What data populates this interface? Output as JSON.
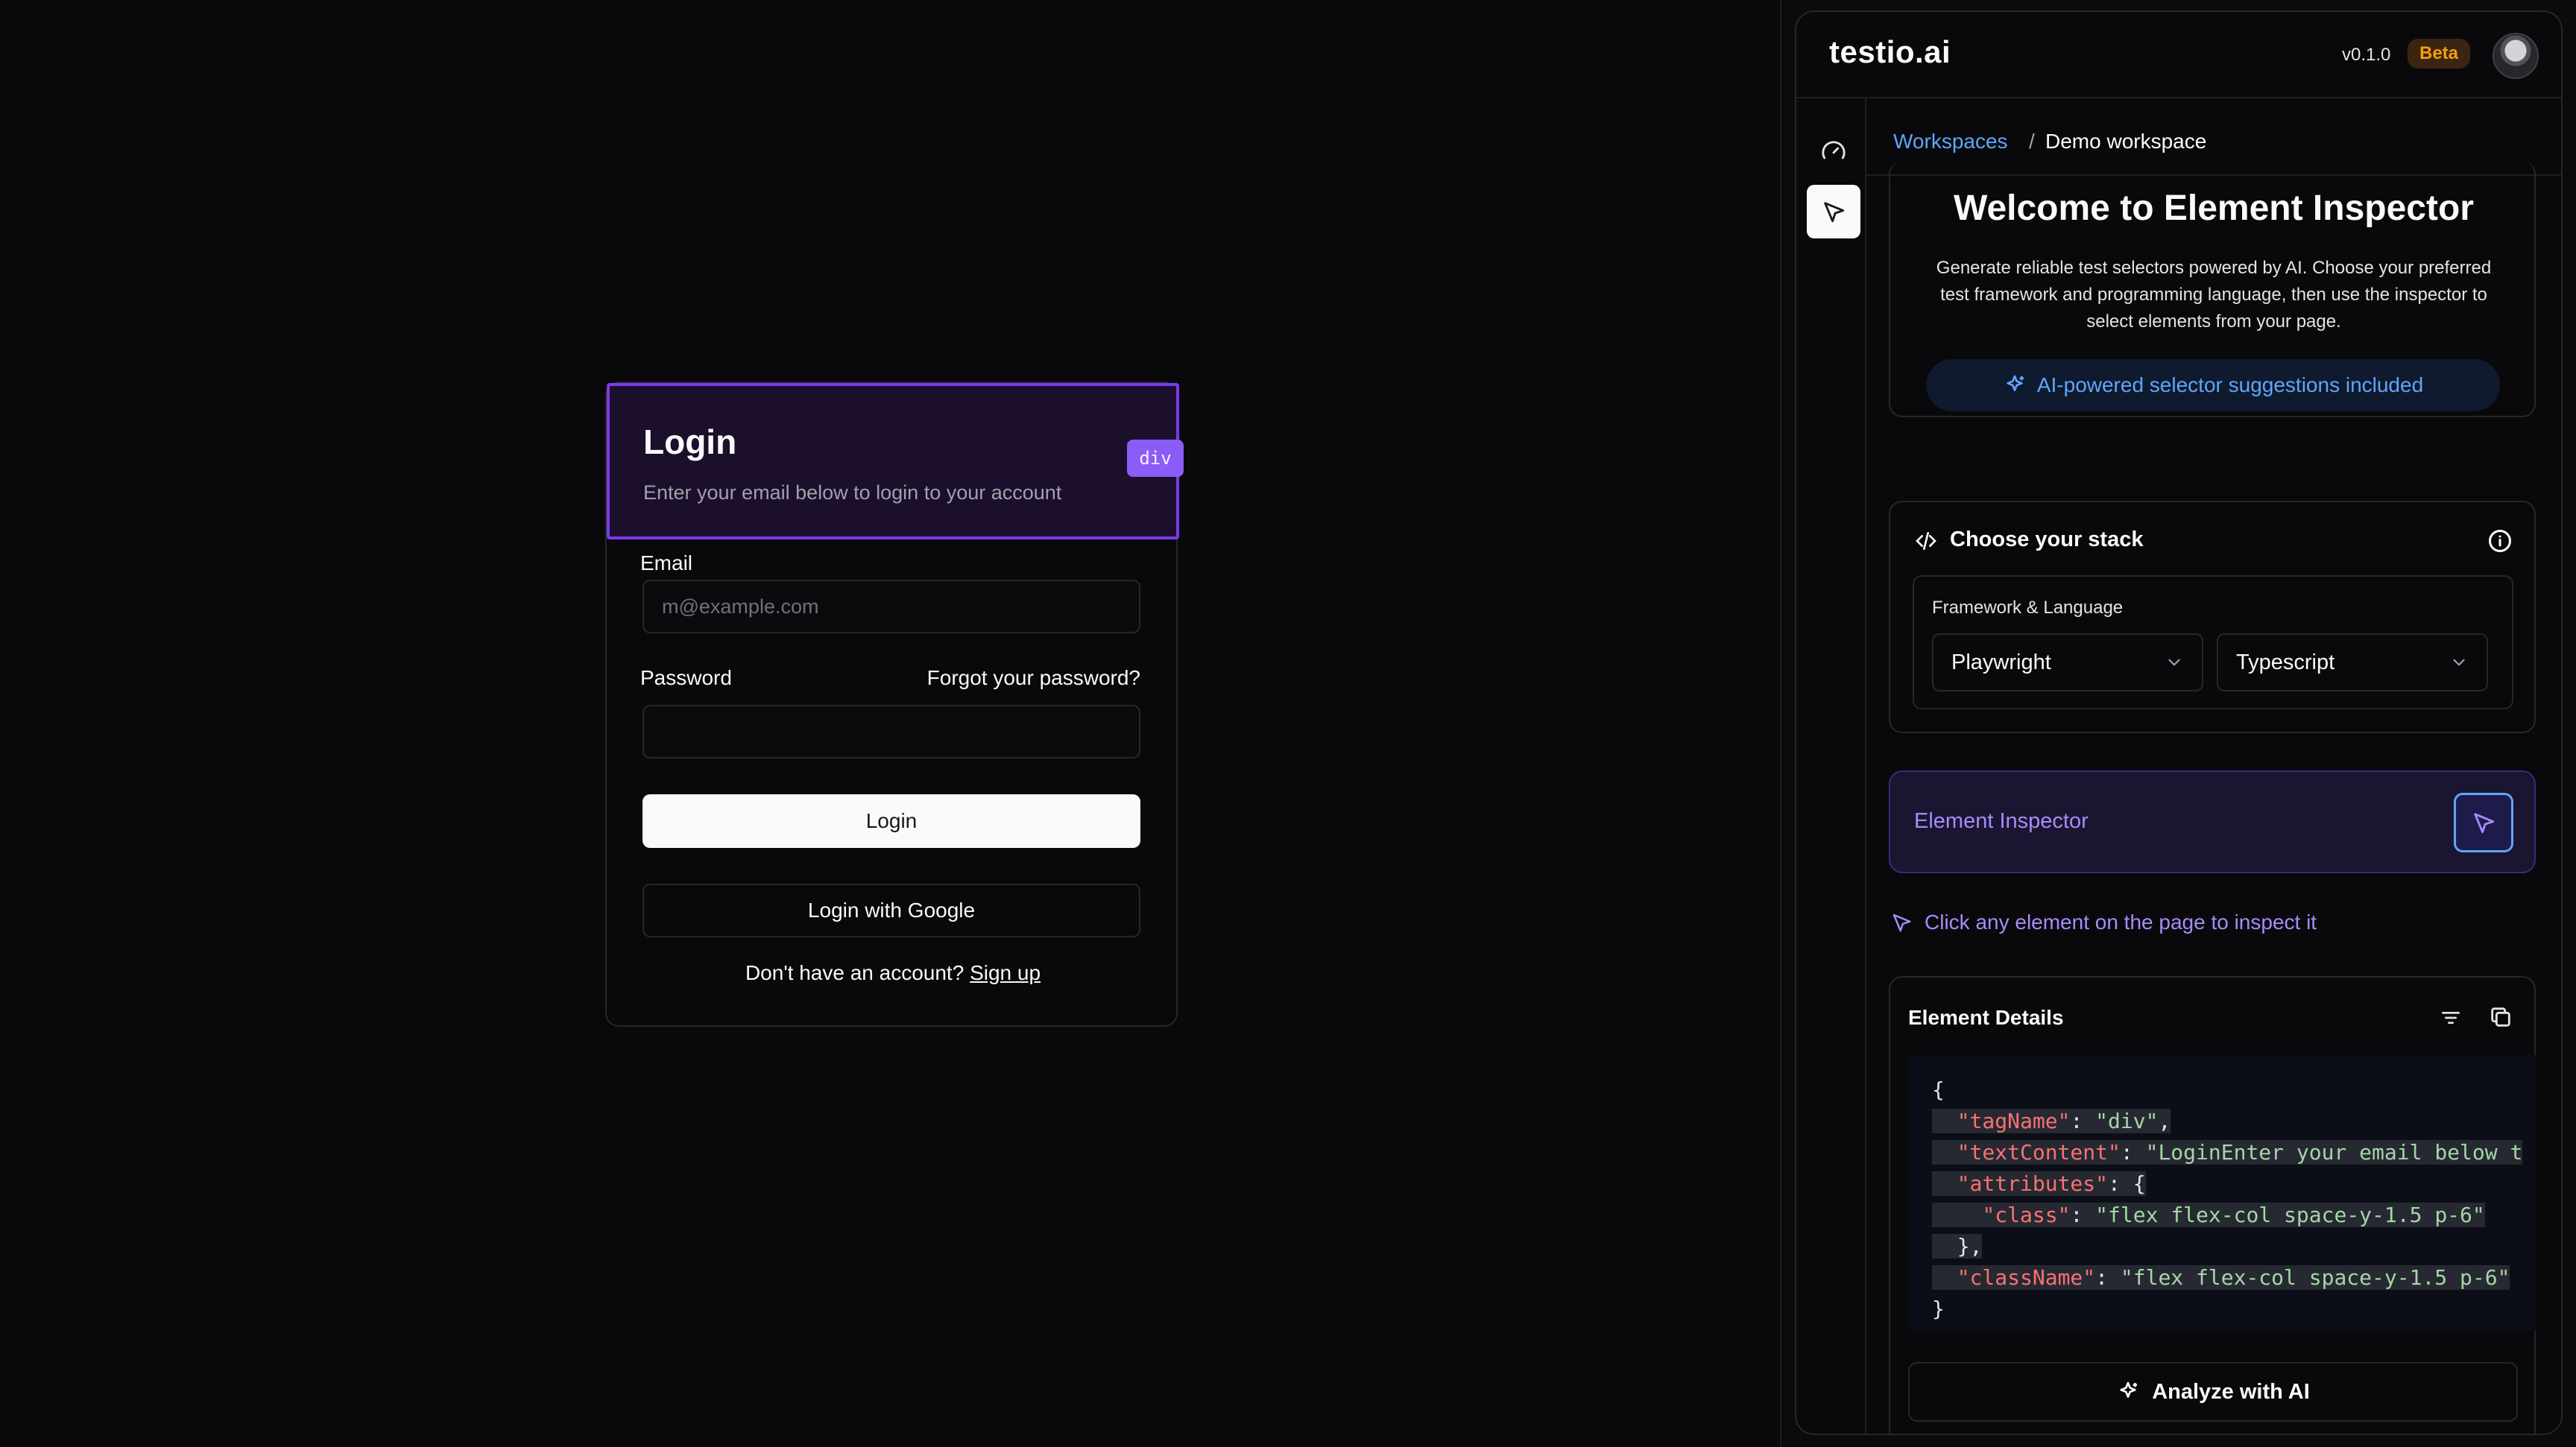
{
  "login": {
    "title": "Login",
    "subtitle": "Enter your email below to login to your account",
    "inspect_tag": "div",
    "email_label": "Email",
    "email_placeholder": "m@example.com",
    "password_label": "Password",
    "forgot_label": "Forgot your password?",
    "login_button": "Login",
    "google_button": "Login with Google",
    "no_account": "Don't have an account?",
    "signup_link": "Sign up"
  },
  "panel": {
    "brand": "testio.ai",
    "version": "v0.1.0",
    "beta": "Beta",
    "breadcrumb": {
      "workspaces": "Workspaces",
      "separator": "/",
      "current": "Demo workspace"
    },
    "welcome": {
      "title": "Welcome to Element Inspector",
      "body": "Generate reliable test selectors powered by AI. Choose your preferred test framework and programming language, then use the inspector to select elements from your page.",
      "ai_pill": "AI-powered selector suggestions included"
    },
    "stack": {
      "title": "Choose your stack",
      "fw_label": "Framework & Language",
      "framework": "Playwright",
      "language": "Typescript"
    },
    "inspector": {
      "label": "Element Inspector",
      "hint": "Click any element on the page to inspect it"
    },
    "details": {
      "title": "Element Details",
      "json": {
        "open": "{",
        "tagName_key": "\"tagName\"",
        "tagName_val": "\"div\"",
        "textContent_key": "\"textContent\"",
        "textContent_val": "\"LoginEnter your email below t",
        "attributes_key": "\"attributes\"",
        "class_key": "\"class\"",
        "class_val": "\"flex flex-col space-y-1.5 p-6\"",
        "className_key": "\"className\"",
        "className_val": "\"flex flex-col space-y-1.5 p-6\"",
        "close": "}"
      },
      "analyze_button": "Analyze with AI"
    }
  },
  "colors": {
    "accent_purple": "#7c3aed",
    "link_blue": "#60a5fa",
    "beta_orange": "#f59e0b",
    "inspector_violet": "#a78bfa"
  }
}
